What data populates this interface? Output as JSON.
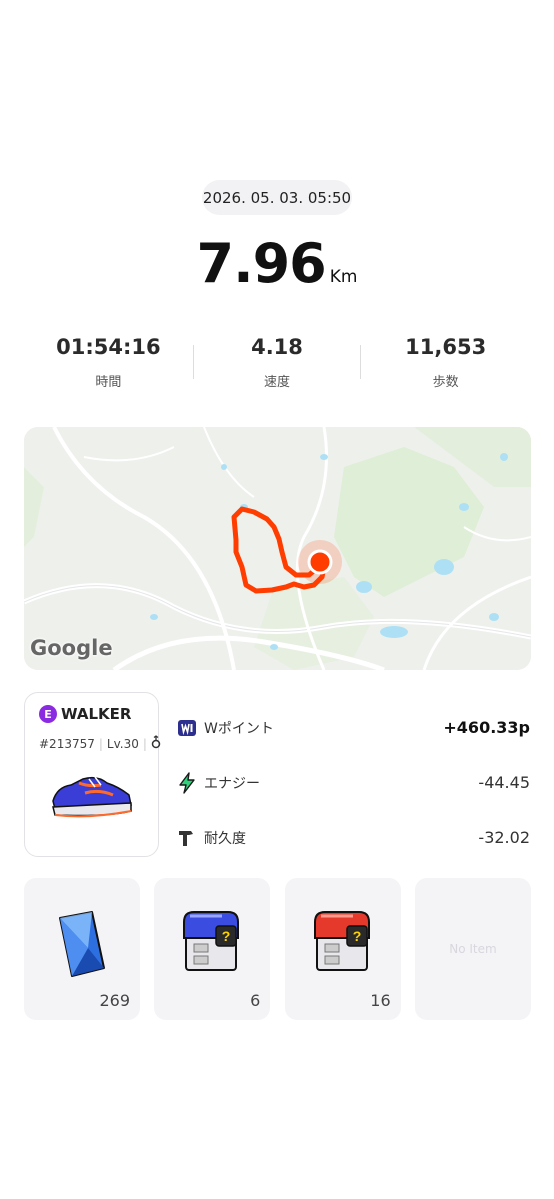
{
  "activity": {
    "datetime": "2026. 05. 03. 05:50",
    "distance": "7.96",
    "distance_unit": "Km"
  },
  "stats": [
    {
      "value": "01:54:16",
      "label": "時間"
    },
    {
      "value": "4.18",
      "label": "速度"
    },
    {
      "value": "11,653",
      "label": "歩数"
    }
  ],
  "map": {
    "attribution": "Google",
    "route_color": "#ff3d00"
  },
  "nft": {
    "badge": "E",
    "name": "WALKER",
    "id": "#213757",
    "level": "Lv.30",
    "extra_icon": "gender-icon",
    "badge_color": "#8a2be2"
  },
  "rewards": [
    {
      "icon": "w-point-icon",
      "label": "Wポイント",
      "value": "+460.33p"
    },
    {
      "icon": "lightning-icon",
      "label": "エナジー",
      "value": "-44.45"
    },
    {
      "icon": "hammer-icon",
      "label": "耐久度",
      "value": "-32.02"
    }
  ],
  "items": [
    {
      "icon": "blue-gem-icon",
      "count": "269"
    },
    {
      "icon": "blue-mystery-box-icon",
      "count": "6"
    },
    {
      "icon": "red-mystery-box-icon",
      "count": "16"
    },
    {
      "icon": "",
      "count": "",
      "empty_label": "No Item"
    }
  ]
}
